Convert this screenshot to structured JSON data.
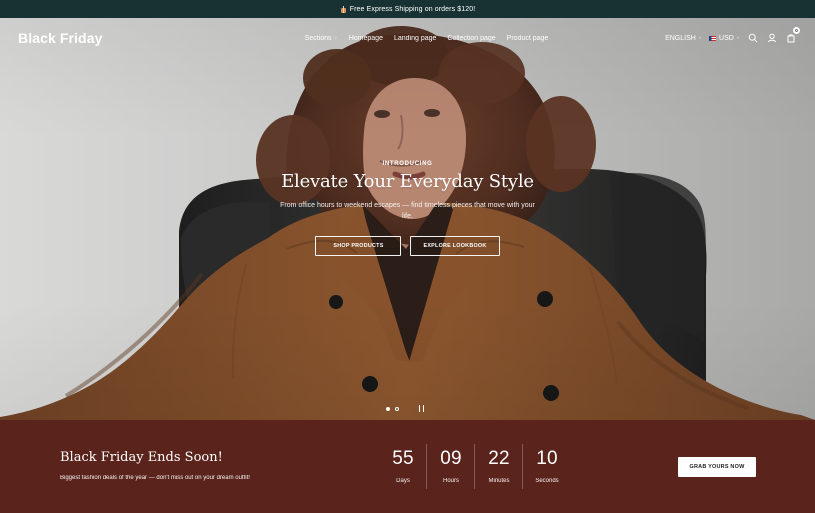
{
  "announcement": {
    "icon": "gift-icon",
    "text": "Free Express Shipping on orders $120!"
  },
  "header": {
    "logo": "Black Friday",
    "nav": [
      {
        "label": "Sections",
        "has_dropdown": true
      },
      {
        "label": "Homepage",
        "has_dropdown": false
      },
      {
        "label": "Landing page",
        "has_dropdown": false
      },
      {
        "label": "Collection page",
        "has_dropdown": false
      },
      {
        "label": "Product page",
        "has_dropdown": false
      }
    ],
    "language": "ENGLISH",
    "currency": "USD",
    "currency_flag_icon": "us-flag-icon",
    "search_icon": "search-icon",
    "account_icon": "user-icon",
    "cart_icon": "shopping-bag-icon",
    "cart_count": "0"
  },
  "hero": {
    "eyebrow": "INTRODUCING",
    "title": "Elevate Your Everyday Style",
    "subtitle": "From office hours to weekend escapes — find timeless pieces that move with your life.",
    "primary_button": "SHOP PRODUCTS",
    "secondary_button": "EXPLORE LOOKBOOK",
    "slider": {
      "active_index": 1,
      "total": 2,
      "pause_icon": "pause-icon"
    },
    "colors": {
      "background": "#d1d1d0",
      "coat": "#7b4a2a",
      "chair": "#2c2b2a",
      "hair": "#4a2d20",
      "skin": "#b88a73"
    }
  },
  "promo": {
    "title": "Black Friday Ends Soon!",
    "subtitle": "Biggest fashion deals of the year — don't miss out on your dream outfit!",
    "countdown": [
      {
        "value": "55",
        "label": "Days"
      },
      {
        "value": "09",
        "label": "Hours"
      },
      {
        "value": "22",
        "label": "Minutes"
      },
      {
        "value": "10",
        "label": "Seconds"
      }
    ],
    "button": "GRAB YOURS NOW",
    "background": "#5a231c"
  },
  "theme": {
    "top_bar": "#183233",
    "text": "#ffffff",
    "accent_dark": "#1f1f1f"
  }
}
